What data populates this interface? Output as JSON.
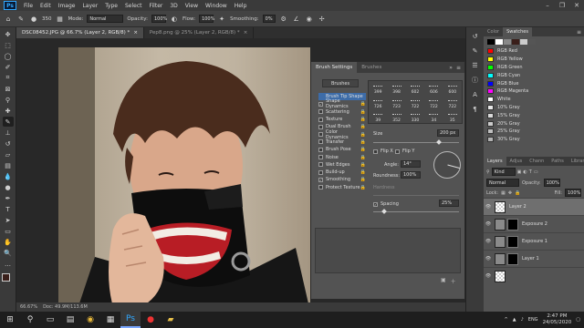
{
  "menu": {
    "logo": "Ps",
    "items": [
      "File",
      "Edit",
      "Image",
      "Layer",
      "Type",
      "Select",
      "Filter",
      "3D",
      "View",
      "Window",
      "Help"
    ]
  },
  "window_controls": [
    "–",
    "❐",
    "✕"
  ],
  "options_bar": {
    "size": "350",
    "mode_label": "Mode:",
    "mode_value": "Normal",
    "opacity_label": "Opacity:",
    "opacity_value": "100%",
    "flow_label": "Flow:",
    "flow_value": "100%",
    "smoothing_label": "Smoothing:",
    "smoothing_value": "0%"
  },
  "doc_tabs": [
    {
      "label": "DSC08452.JPG @ 66.7% (Layer 2, RGB/8) *",
      "close": "×",
      "active": true
    },
    {
      "label": "Pep8.png @ 25% (Layer 2, RGB/8) *",
      "close": "×",
      "active": false
    }
  ],
  "brush_panel": {
    "tabs": [
      "Brush Settings",
      "Brushes"
    ],
    "brushes_button": "Brushes",
    "options": [
      {
        "label": "Brush Tip Shape",
        "checked": null,
        "selected": true
      },
      {
        "label": "Shape Dynamics",
        "checked": true
      },
      {
        "label": "Scattering",
        "checked": false
      },
      {
        "label": "Texture",
        "checked": false
      },
      {
        "label": "Dual Brush",
        "checked": false
      },
      {
        "label": "Color Dynamics",
        "checked": false
      },
      {
        "label": "Transfer",
        "checked": false
      },
      {
        "label": "Brush Pose",
        "checked": false
      },
      {
        "label": "Noise",
        "checked": false
      },
      {
        "label": "Wet Edges",
        "checked": false
      },
      {
        "label": "Build-up",
        "checked": false
      },
      {
        "label": "Smoothing",
        "checked": true
      },
      {
        "label": "Protect Texture",
        "checked": false
      }
    ],
    "presets": [
      "399",
      "398",
      "602",
      "606",
      "600",
      "726",
      "723",
      "722",
      "722",
      "722",
      "39",
      "352",
      "330",
      "34",
      "35"
    ],
    "size_label": "Size",
    "size_value": "200 px",
    "flip_x": "Flip X",
    "flip_y": "Flip Y",
    "angle_label": "Angle:",
    "angle_value": "14°",
    "roundness_label": "Roundness:",
    "roundness_value": "100%",
    "hardness_label": "Hardness",
    "spacing_label": "Spacing",
    "spacing_value": "25%",
    "spacing_checked": true
  },
  "swatches_panel": {
    "tabs": [
      "Color",
      "Swatches"
    ],
    "swatches": [
      {
        "name": "RGB Red",
        "color": "#ff0000"
      },
      {
        "name": "RGB Yellow",
        "color": "#ffff00"
      },
      {
        "name": "RGB Green",
        "color": "#00ff00"
      },
      {
        "name": "RGB Cyan",
        "color": "#00ffff"
      },
      {
        "name": "RGB Blue",
        "color": "#0000ff"
      },
      {
        "name": "RGB Magenta",
        "color": "#ff00ff"
      },
      {
        "name": "White",
        "color": "#ffffff"
      },
      {
        "name": "10% Gray",
        "color": "#e6e6e6"
      },
      {
        "name": "15% Gray",
        "color": "#d9d9d9"
      },
      {
        "name": "20% Gray",
        "color": "#cccccc"
      },
      {
        "name": "25% Gray",
        "color": "#bfbfbf"
      },
      {
        "name": "30% Gray",
        "color": "#b3b3b3"
      }
    ]
  },
  "layers_panel": {
    "tabs": [
      "Layers",
      "Adjus",
      "Chann",
      "Paths",
      "Librari"
    ],
    "kind_label": "Kind",
    "blend_mode": "Normal",
    "opacity_label": "Opacity:",
    "opacity_value": "100%",
    "lock_label": "Lock:",
    "fill_label": "Fill:",
    "fill_value": "100%",
    "layers": [
      {
        "name": "Layer 2",
        "selected": true,
        "has_mask": false
      },
      {
        "name": "Exposure 2",
        "selected": false,
        "has_mask": true
      },
      {
        "name": "Exposure 1",
        "selected": false,
        "has_mask": true
      },
      {
        "name": "Layer 1",
        "selected": false,
        "has_mask": true
      },
      {
        "name": "",
        "selected": false,
        "has_mask": false
      }
    ]
  },
  "status_bar": {
    "zoom": "66.67%",
    "doc": "Doc: 49.9M/113.6M"
  },
  "taskbar": {
    "language": "ENG",
    "time": "2:47 PM",
    "date": "24/05/2020"
  }
}
